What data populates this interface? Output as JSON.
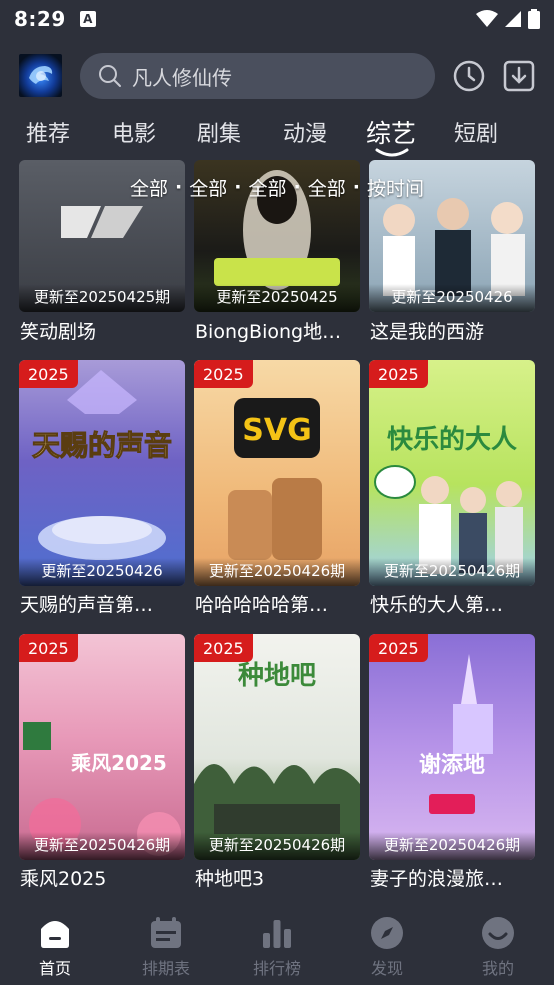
{
  "status": {
    "time": "8:29",
    "app_icon_letter": "A"
  },
  "search": {
    "placeholder": "凡人修仙传"
  },
  "tabs": [
    {
      "label": "推荐"
    },
    {
      "label": "电影"
    },
    {
      "label": "剧集"
    },
    {
      "label": "动漫"
    },
    {
      "label": "综艺",
      "active": true
    },
    {
      "label": "短剧"
    }
  ],
  "filters": [
    "全部",
    "全部",
    "全部",
    "全部",
    "按时间"
  ],
  "cards": [
    {
      "title": "笑动剧场",
      "update": "更新至20250425期",
      "year": ""
    },
    {
      "title": "BiongBiong地…",
      "update": "更新至20250425",
      "year": ""
    },
    {
      "title": "这是我的西游",
      "update": "更新至20250426",
      "year": ""
    },
    {
      "title": "天赐的声音第…",
      "update": "更新至20250426",
      "year": "2025"
    },
    {
      "title": "哈哈哈哈哈第…",
      "update": "更新至20250426期",
      "year": "2025"
    },
    {
      "title": "快乐的大人第…",
      "update": "更新至20250426期",
      "year": "2025"
    },
    {
      "title": "乘风2025",
      "update": "更新至20250426期",
      "year": "2025"
    },
    {
      "title": "种地吧3",
      "update": "更新至20250426期",
      "year": "2025"
    },
    {
      "title": "妻子的浪漫旅…",
      "update": "更新至20250426期",
      "year": "2025"
    }
  ],
  "poster_text": {
    "card4": "天赐的声音",
    "card5": "SVG",
    "card6": "快乐的大人",
    "card7": "乘风2025",
    "card8": "种地吧",
    "card9": "谢添地"
  },
  "nav": [
    {
      "label": "首页",
      "icon": "home-icon",
      "active": true
    },
    {
      "label": "排期表",
      "icon": "calendar-icon"
    },
    {
      "label": "排行榜",
      "icon": "ranking-icon"
    },
    {
      "label": "发现",
      "icon": "compass-icon"
    },
    {
      "label": "我的",
      "icon": "profile-icon"
    }
  ],
  "colors": {
    "background": "#2d303a",
    "badge": "#d61c1c",
    "search_bg": "#4a4f5d",
    "nav_inactive": "#6f7380"
  }
}
